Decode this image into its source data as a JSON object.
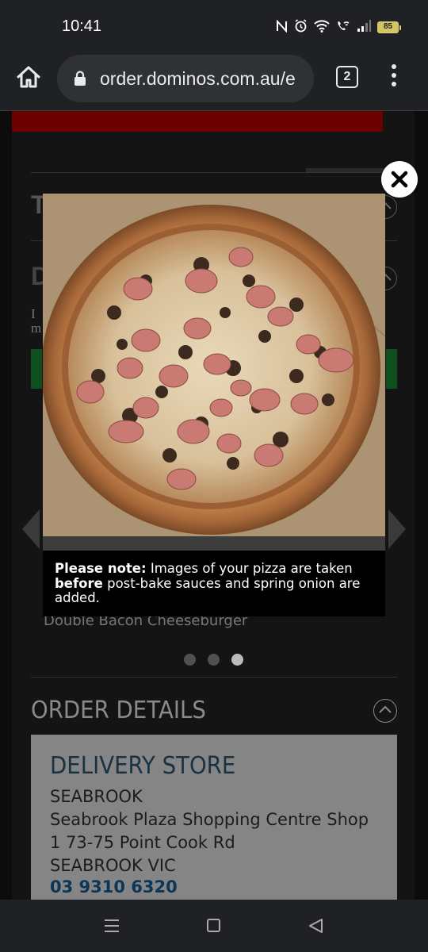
{
  "status_bar": {
    "time": "10:41",
    "battery_level": "85",
    "icons": [
      "nfc-icon",
      "alarm-icon",
      "wifi-icon",
      "wifi-calling-icon",
      "signal-icon",
      "battery-icon"
    ]
  },
  "browser": {
    "url": "order.dominos.com.au/e",
    "tab_count": "2",
    "icons": [
      "home-icon",
      "lock-icon",
      "tabs-icon",
      "more-vert-icon"
    ]
  },
  "background_page": {
    "pizza_name": "Double Bacon Cheeseburger",
    "carousel": {
      "total": 3,
      "active_index": 2
    },
    "order_details_title": "ORDER DETAILS",
    "delivery_store": {
      "title": "DELIVERY STORE",
      "lines": [
        "SEABROOK",
        "Seabrook Plaza Shopping Centre Shop",
        "1 73-75 Point Cook Rd",
        "SEABROOK VIC"
      ],
      "phone": "03 9310 6320"
    }
  },
  "modal": {
    "image_alt": "Photo of a Double Bacon Cheeseburger pizza",
    "note_label": "Please note:",
    "note_text_1": "Images of your pizza are taken",
    "note_emphasis": "before",
    "note_text_2": "post-bake sauces and spring onion are added."
  },
  "colors": {
    "brand_red": "#6d0000",
    "store_title": "#193241",
    "phone_link": "#0d3555",
    "battery": "#d3c565"
  }
}
